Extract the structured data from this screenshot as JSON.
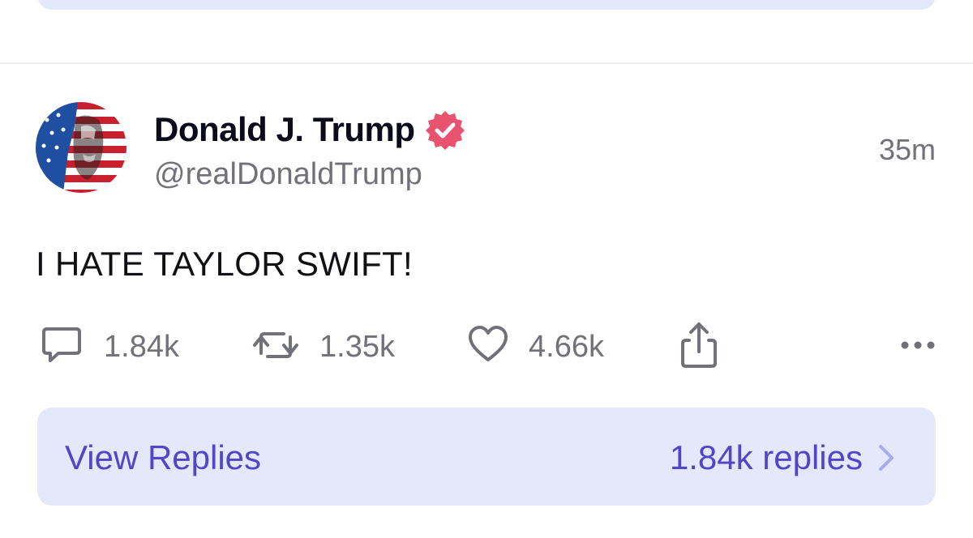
{
  "post": {
    "author": {
      "display_name": "Donald J. Trump",
      "handle": "@realDonaldTrump",
      "verified": true,
      "verified_color": "#e8536f",
      "avatar_icon": "flag-portrait-avatar"
    },
    "timestamp": "35m",
    "text": "I HATE TAYLOR SWIFT!",
    "actions": {
      "replies": "1.84k",
      "reposts": "1.35k",
      "likes": "4.66k",
      "share_icon": "share-icon",
      "more_icon": "more-icon"
    }
  },
  "replies_bar": {
    "label": "View Replies",
    "count_label": "1.84k replies",
    "background": "#e3e8fa",
    "accent": "#4f46c8"
  }
}
